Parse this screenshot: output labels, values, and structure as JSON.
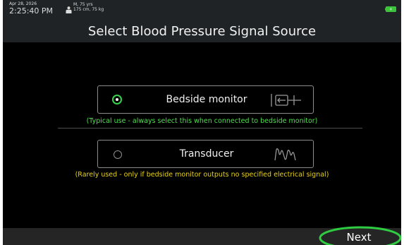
{
  "status": {
    "date": "Apr 28, 2026",
    "time": "2:25:40 PM",
    "patient_line1": "M, 75 yrs",
    "patient_line2": "175 cm, 75 kg"
  },
  "title": "Select Blood Pressure Signal Source",
  "options": [
    {
      "label": "Bedside monitor",
      "selected": true,
      "icon": "monitor-cable-icon",
      "hint": "(Typical use - always select this when connected to bedside monitor)"
    },
    {
      "label": "Transducer",
      "selected": false,
      "icon": "waveform-icon",
      "hint": "(Rarely used - only if bedside monitor outputs no specified electrical signal)"
    }
  ],
  "footer": {
    "next_label": "Next"
  },
  "colors": {
    "background": "#000000",
    "selected_green": "#35d24a",
    "hint_green": "#4fe04f",
    "hint_yellow": "#e8d21a",
    "highlight_ellipse": "#2ecc40"
  }
}
